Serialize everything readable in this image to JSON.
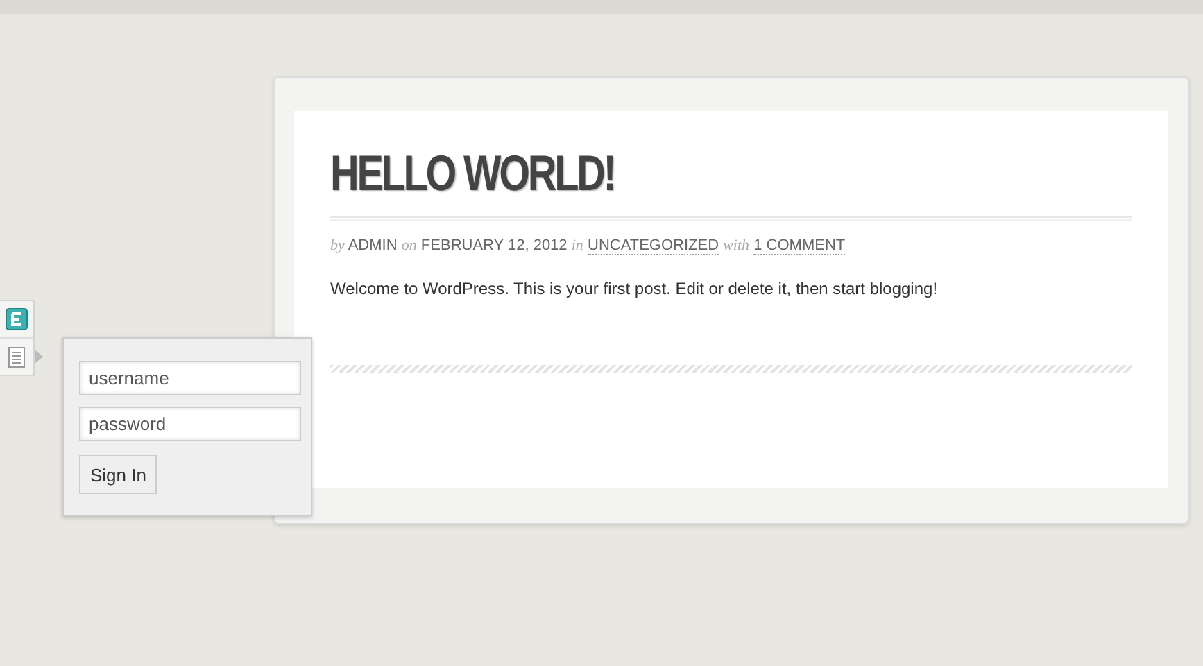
{
  "post": {
    "title": "HELLO WORLD!",
    "meta": [
      {
        "kind": "word",
        "text": "by"
      },
      {
        "kind": "text",
        "text": "ADMIN"
      },
      {
        "kind": "word",
        "text": "on"
      },
      {
        "kind": "text",
        "text": "FEBRUARY 12, 2012"
      },
      {
        "kind": "word",
        "text": "in"
      },
      {
        "kind": "link",
        "text": "UNCATEGORIZED"
      },
      {
        "kind": "word",
        "text": "with"
      },
      {
        "kind": "link",
        "text": "1 COMMENT"
      }
    ],
    "body": "Welcome to WordPress. This is your first post. Edit or delete it, then start blogging!"
  },
  "login": {
    "username": {
      "placeholder": "username"
    },
    "password": {
      "placeholder": "password"
    },
    "button": "Sign In"
  }
}
